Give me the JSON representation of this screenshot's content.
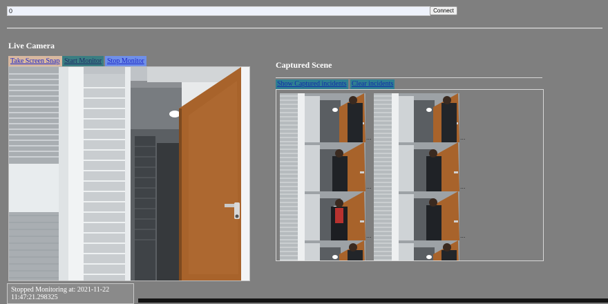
{
  "connection": {
    "url_value": "0",
    "connect_label": "Connect"
  },
  "live": {
    "title": "Live Camera",
    "snap_label": "Take Screen Snap",
    "start_label": "Start Monitor",
    "stop_label": "Stop Monitor",
    "tab_colors": {
      "snap": "#d8b8a0",
      "start": "#3a7e82",
      "stop": "#6f8fe8"
    }
  },
  "captured": {
    "title": "Captured Scene",
    "show_label": "Show Captured incidents",
    "clear_label": "Clear incidents",
    "thumbnails": [
      {
        "person": "right-edge"
      },
      {
        "person": "right-edge"
      },
      {
        "person": "door"
      },
      {
        "person": "door"
      },
      {
        "person": "center-red-shirt"
      },
      {
        "person": "door"
      },
      {
        "person": "right-edge"
      },
      {
        "person": "right-edge"
      }
    ],
    "ellipsis": "..."
  },
  "status": {
    "line1": "Stopped Monitoring at: 2021-11-22",
    "line2": "11:47:21.298325"
  },
  "colors": {
    "page_bg": "#7f7f7f",
    "door_wood": "#a8632b",
    "link_blue": "#1b24c8"
  }
}
